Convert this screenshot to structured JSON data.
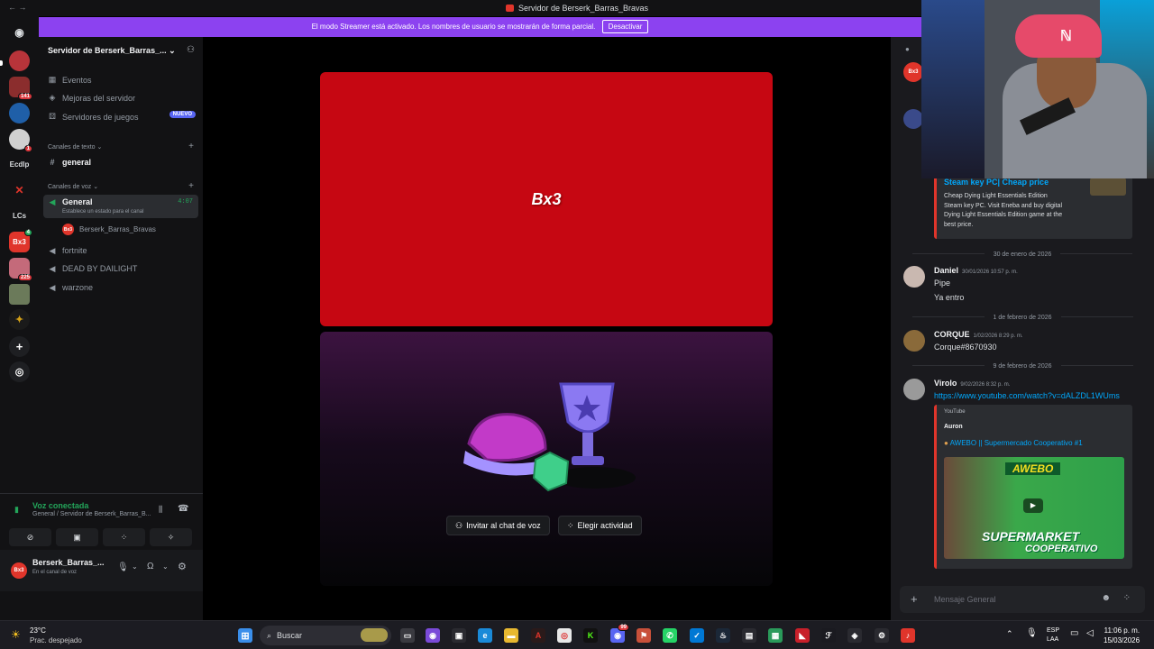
{
  "window": {
    "title": "Servidor de Berserk_Barras_Bravas"
  },
  "banner": {
    "text": "El modo Streamer está activado. Los nombres de usuario se mostrarán de forma parcial.",
    "button": "Desactivar"
  },
  "guilds": {
    "items": [
      {
        "badge": ""
      },
      {
        "badge": "141"
      },
      {
        "badge": ""
      },
      {
        "badge": "1"
      },
      {
        "label": "Ecdlp"
      },
      {
        "badge": ""
      },
      {
        "label": "LCs"
      },
      {
        "label": "Bx3",
        "badge": "4"
      },
      {
        "badge": "225"
      },
      {
        "badge": ""
      },
      {
        "badge": ""
      }
    ]
  },
  "sidebar": {
    "server_name": "Servidor de Berserk_Barras_...",
    "events": "Eventos",
    "boosts": "Mejoras del servidor",
    "game_servers": "Servidores de juegos",
    "new_badge": "NUEVO",
    "text_category": "Canales de texto",
    "text_channel": "general",
    "voice_category": "Canales de voz",
    "voice_channel_active": {
      "name": "General",
      "timer": "4:07",
      "status": "Establece un estado para el canal"
    },
    "voice_member": "Berserk_Barras_Bravas",
    "voice_channels": [
      "fortnite",
      "DEAD BY DAILIGHT",
      "warzone"
    ]
  },
  "voice_panel": {
    "title": "Voz conectada",
    "subtitle": "General / Servidor de Berserk_Barras_B..."
  },
  "user": {
    "name": "Berserk_Barras_...",
    "status": "En el canal de voz"
  },
  "stage": {
    "logo": "Bx3",
    "invite": "Invitar al chat de voz",
    "activity": "Elegir actividad"
  },
  "chat": {
    "top_embed": {
      "title": "Steam key PC| Cheap price",
      "text": [
        "Cheap Dying Light Essentials Edition",
        "Steam key PC. Visit Eneba and buy digital",
        "Dying Light Essentials Edition game at the",
        "best price."
      ]
    },
    "messages": [
      {
        "date": "30 de enero de 2026",
        "author": "Daniel",
        "time": "30/01/2026 10:57 p. m.",
        "lines": [
          "Pipe",
          "Ya entro"
        ]
      },
      {
        "date": "1 de febrero de 2026",
        "author": "CORQUE",
        "time": "1/02/2026 8:29 p. m.",
        "lines": [
          "Corque#8670930"
        ]
      },
      {
        "date": "9 de febrero de 2026",
        "author": "Virolo",
        "time": "9/02/2026 8:32 p. m.",
        "lines": [
          "https://www.youtube.com/watch?v=dALZDL1WUms"
        ]
      }
    ],
    "yt_embed": {
      "provider": "YouTube",
      "author": "Auron",
      "title": "AWEBO || Supermercado Cooperativo #1",
      "thumb_top": "AWEBO",
      "thumb_bottom": "SUPERMARKET",
      "thumb_bottom2": "COOPERATIVO"
    },
    "composer_placeholder": "Mensaje General"
  },
  "taskbar": {
    "weather_temp": "23°C",
    "weather_desc": "Prac. despejado",
    "search": "Buscar",
    "lang": "ESP",
    "lang2": "LAA",
    "time": "11:06 p. m.",
    "date": "15/03/2026",
    "discord_badge": "99"
  },
  "colors": {
    "accent": "#5865f2",
    "streamer": "#8c42f0",
    "voice": "#23a55a",
    "tile": "#c60712"
  }
}
